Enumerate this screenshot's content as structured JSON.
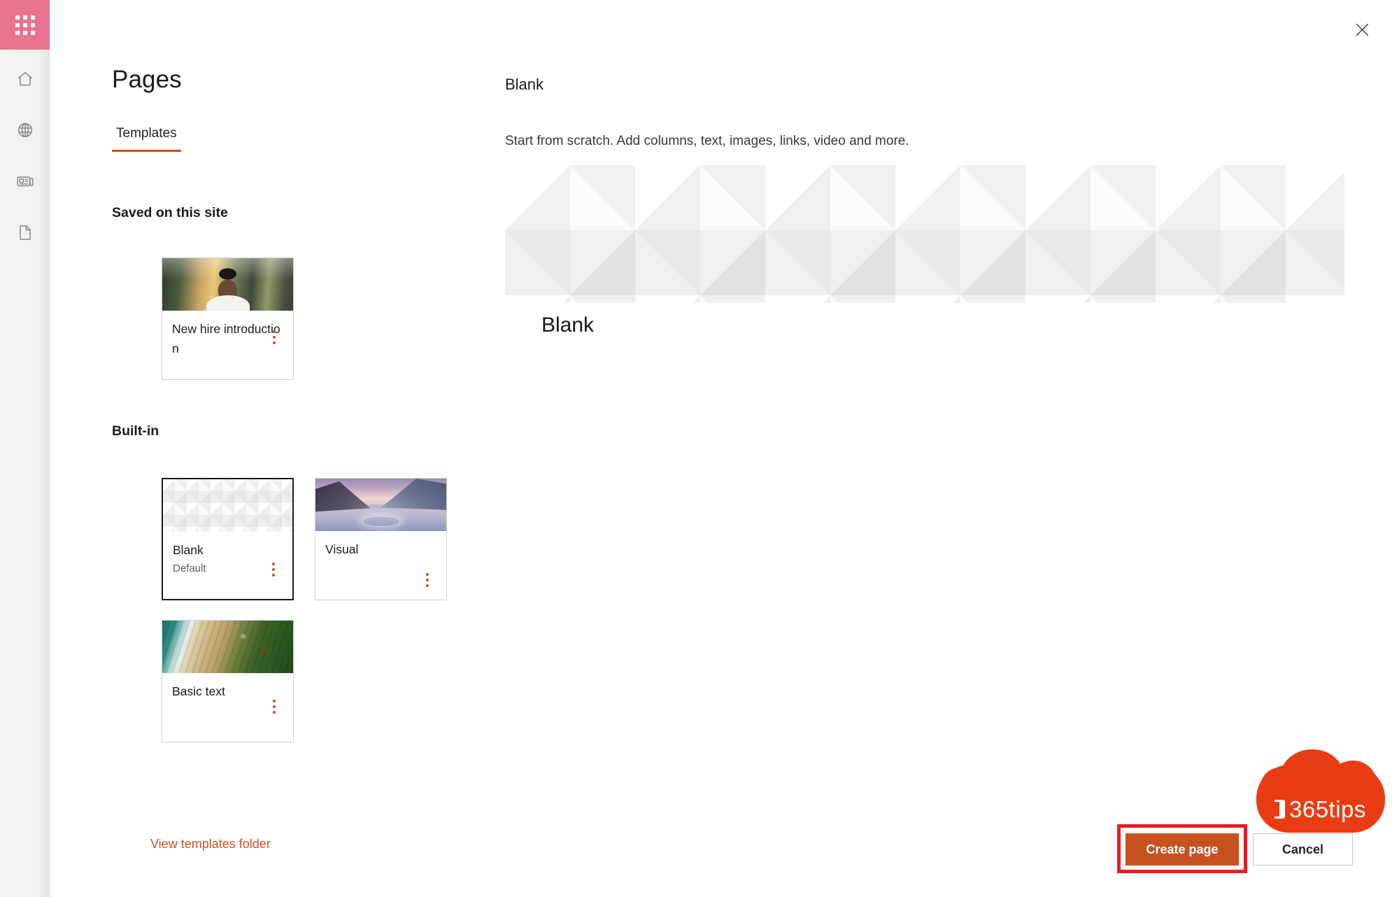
{
  "app": {
    "waffle_label": "app-launcher",
    "close_label": "Close",
    "rail_items": [
      {
        "icon": "home-icon",
        "label": "Home"
      },
      {
        "icon": "globe-icon",
        "label": "Sites"
      },
      {
        "icon": "news-icon",
        "label": "News"
      },
      {
        "icon": "document-icon",
        "label": "Files"
      }
    ]
  },
  "left_panel": {
    "title": "Pages",
    "tabs": [
      {
        "label": "Templates",
        "active": true
      }
    ],
    "groups": [
      {
        "label": "Saved on this site"
      },
      {
        "label": "Built-in"
      }
    ],
    "cards": {
      "new_hire": {
        "name": "New hire introduction",
        "subtitle": "",
        "thumb": "person-photo",
        "selected": false,
        "menu": "more-options-icon"
      },
      "blank": {
        "name": "Blank",
        "subtitle": "Default",
        "thumb": "geometric-pattern",
        "selected": true,
        "menu": "more-options-icon"
      },
      "visual": {
        "name": "Visual",
        "subtitle": "",
        "thumb": "lake-sunrise-photo",
        "selected": false,
        "menu": "more-options-icon"
      },
      "basic_text": {
        "name": "Basic text",
        "subtitle": "",
        "thumb": "aerial-beach-photo",
        "selected": false,
        "menu": "more-options-icon"
      }
    },
    "templates_folder_link": "View templates folder"
  },
  "detail": {
    "title": "Blank",
    "description": "Start from scratch. Add columns, text, images, links, video and more.",
    "preview_heading": "Blank"
  },
  "footer": {
    "create_label": "Create page",
    "cancel_label": "Cancel"
  },
  "watermark": {
    "text": "365tips",
    "logo": "office-logo-icon"
  },
  "colors": {
    "accent_orange": "#c8521f",
    "waffle_pink": "#e8738f",
    "highlight_red": "#ed1c24",
    "watermark_orange": "#ea3c12"
  }
}
